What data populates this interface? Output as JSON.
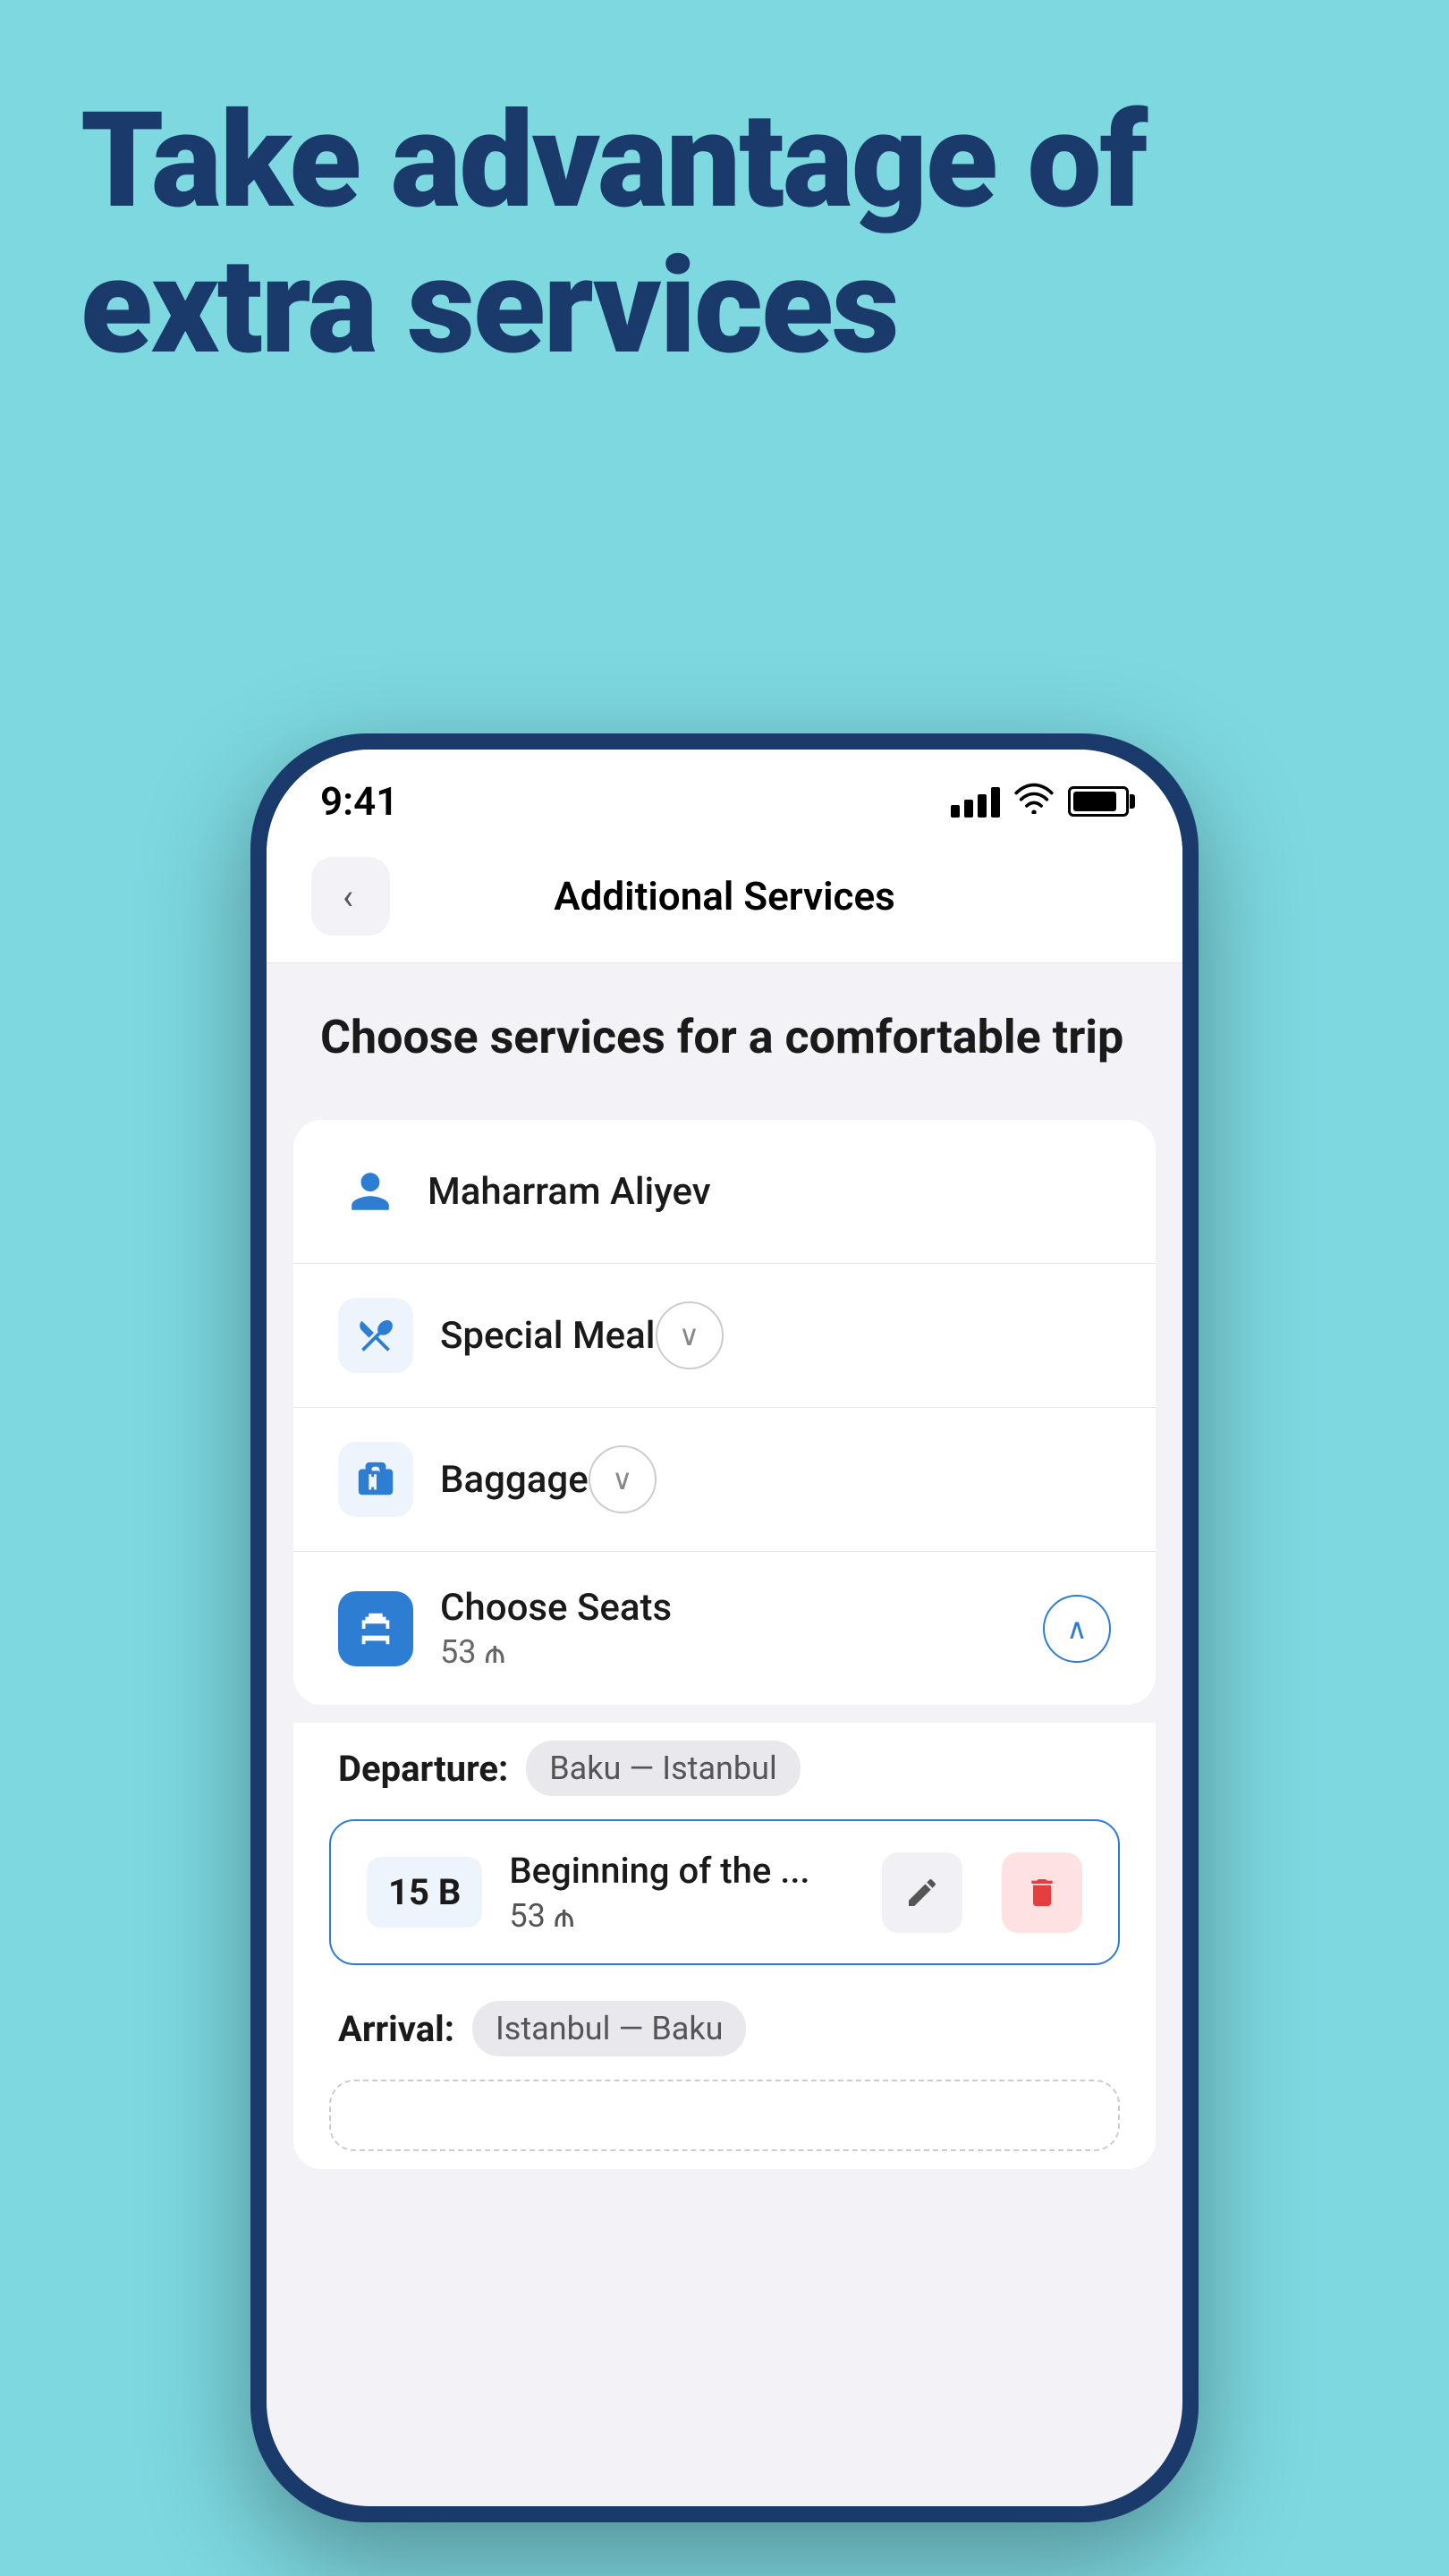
{
  "hero": {
    "title": "Take advantage of extra services"
  },
  "status_bar": {
    "time": "9:41"
  },
  "nav": {
    "back_label": "<",
    "title": "Additional Services"
  },
  "section": {
    "heading": "Choose services for a comfortable trip"
  },
  "passenger": {
    "name": "Maharram Aliyev"
  },
  "services": [
    {
      "id": "special-meal",
      "name": "Special Meal",
      "price": "",
      "expanded": false,
      "icon": "meal"
    },
    {
      "id": "baggage",
      "name": "Baggage",
      "price": "",
      "expanded": false,
      "icon": "baggage"
    },
    {
      "id": "choose-seats",
      "name": "Choose Seats",
      "price": "53 ₼",
      "expanded": true,
      "icon": "seat"
    }
  ],
  "seats": {
    "departure_label": "Departure:",
    "departure_route": "Baku — Istanbul",
    "seat_number": "15 B",
    "seat_description": "Beginning of the ...",
    "seat_price": "53 ₼",
    "arrival_label": "Arrival:",
    "arrival_route": "Istanbul — Baku"
  },
  "buttons": {
    "edit_label": "✎",
    "delete_label": "🗑"
  }
}
